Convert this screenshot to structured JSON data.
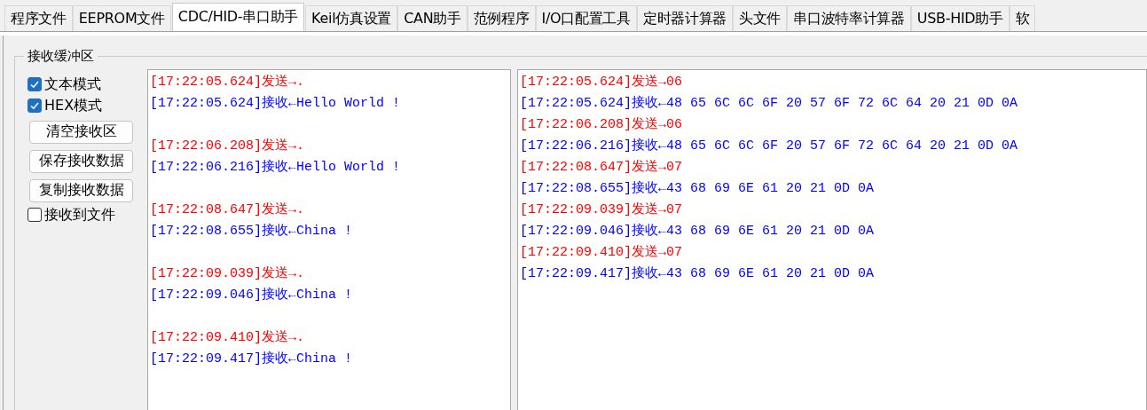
{
  "tabs": [
    {
      "label": "程序文件",
      "selected": false
    },
    {
      "label": "EEPROM文件",
      "selected": false
    },
    {
      "label": "CDC/HID-串口助手",
      "selected": true
    },
    {
      "label": "Keil仿真设置",
      "selected": false
    },
    {
      "label": "CAN助手",
      "selected": false
    },
    {
      "label": "范例程序",
      "selected": false
    },
    {
      "label": "I/O口配置工具",
      "selected": false
    },
    {
      "label": "定时器计算器",
      "selected": false
    },
    {
      "label": "头文件",
      "selected": false
    },
    {
      "label": "串口波特率计算器",
      "selected": false
    },
    {
      "label": "USB-HID助手",
      "selected": false
    },
    {
      "label": "软",
      "selected": false
    }
  ],
  "receive_buffer": {
    "title": "接收缓冲区",
    "controls": [
      {
        "kind": "checkbox",
        "label": "文本模式",
        "checked": true
      },
      {
        "kind": "checkbox",
        "label": "HEX模式",
        "checked": true
      },
      {
        "kind": "button",
        "label": "清空接收区"
      },
      {
        "kind": "button",
        "label": "保存接收数据"
      },
      {
        "kind": "button",
        "label": "复制接收数据"
      },
      {
        "kind": "checkbox",
        "label": "接收到文件",
        "checked": false
      }
    ],
    "text_view": [
      {
        "send": "[17:22:05.624]发送→.",
        "recv": "[17:22:05.624]接收←Hello World !"
      },
      {
        "send": "[17:22:06.208]发送→.",
        "recv": "[17:22:06.216]接收←Hello World !"
      },
      {
        "send": "[17:22:08.647]发送→.",
        "recv": "[17:22:08.655]接收←China !"
      },
      {
        "send": "[17:22:09.039]发送→.",
        "recv": "[17:22:09.046]接收←China !"
      },
      {
        "send": "[17:22:09.410]发送→.",
        "recv": "[17:22:09.417]接收←China !"
      }
    ],
    "hex_view": [
      {
        "kind": "send",
        "text": "[17:22:05.624]发送→06"
      },
      {
        "kind": "recv",
        "text": "[17:22:05.624]接收←48 65 6C 6C 6F 20 57 6F 72 6C 64 20 21 0D 0A"
      },
      {
        "kind": "send",
        "text": "[17:22:06.208]发送→06"
      },
      {
        "kind": "recv",
        "text": "[17:22:06.216]接收←48 65 6C 6C 6F 20 57 6F 72 6C 64 20 21 0D 0A"
      },
      {
        "kind": "send",
        "text": "[17:22:08.647]发送→07"
      },
      {
        "kind": "recv",
        "text": "[17:22:08.655]接收←43 68 69 6E 61 20 21 0D 0A"
      },
      {
        "kind": "send",
        "text": "[17:22:09.039]发送→07"
      },
      {
        "kind": "recv",
        "text": "[17:22:09.046]接收←43 68 69 6E 61 20 21 0D 0A"
      },
      {
        "kind": "send",
        "text": "[17:22:09.410]发送→07"
      },
      {
        "kind": "recv",
        "text": "[17:22:09.417]接收←43 68 69 6E 61 20 21 0D 0A"
      }
    ]
  }
}
